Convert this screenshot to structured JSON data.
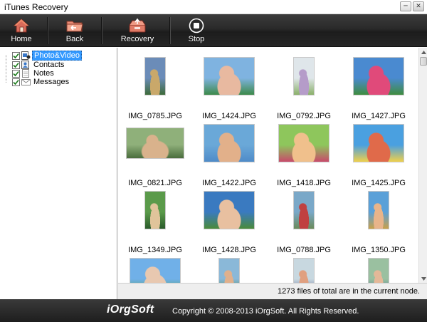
{
  "window": {
    "title": "iTunes Recovery",
    "minimize": "─",
    "close": "✕"
  },
  "toolbar": {
    "home": "Home",
    "back": "Back",
    "recovery": "Recovery",
    "stop": "Stop"
  },
  "tree": {
    "items": [
      {
        "label": "Photo&Video",
        "checked": true,
        "selected": true,
        "icon": "photo-video-icon"
      },
      {
        "label": "Contacts",
        "checked": true,
        "selected": false,
        "icon": "contacts-icon"
      },
      {
        "label": "Notes",
        "checked": true,
        "selected": false,
        "icon": "notes-icon"
      },
      {
        "label": "Messages",
        "checked": true,
        "selected": false,
        "icon": "messages-icon"
      }
    ]
  },
  "files": [
    {
      "name": "IMG_0785.JPG",
      "orient": "portrait",
      "colors": [
        "#6b8cb8",
        "#c9a86a",
        "#3d6b3a"
      ]
    },
    {
      "name": "IMG_1424.JPG",
      "orient": "landscape",
      "colors": [
        "#7fb3e0",
        "#e8b9a0",
        "#3c8a4a"
      ]
    },
    {
      "name": "IMG_0792.JPG",
      "orient": "portrait",
      "colors": [
        "#dfe6ea",
        "#b59cc9",
        "#8ab06a"
      ]
    },
    {
      "name": "IMG_1427.JPG",
      "orient": "landscape",
      "colors": [
        "#4a8ad0",
        "#e04a7a",
        "#3f8c3f"
      ]
    },
    {
      "name": "IMG_0821.JPG",
      "orient": "landscape",
      "colors": [
        "#8fb07a",
        "#d9b28c",
        "#4a6d3d"
      ]
    },
    {
      "name": "IMG_1422.JPG",
      "orient": "landscape",
      "colors": [
        "#6aa8d8",
        "#e2b08a",
        "#4f8bc8"
      ]
    },
    {
      "name": "IMG_1418.JPG",
      "orient": "landscape",
      "colors": [
        "#8ec65c",
        "#f0c08c",
        "#c84a6a"
      ]
    },
    {
      "name": "IMG_1425.JPG",
      "orient": "landscape",
      "colors": [
        "#4aa0e0",
        "#e06a4a",
        "#f0d04a"
      ]
    },
    {
      "name": "IMG_1349.JPG",
      "orient": "portrait",
      "colors": [
        "#5a9a4a",
        "#e0c49a",
        "#2a5a2a"
      ]
    },
    {
      "name": "IMG_1428.JPG",
      "orient": "landscape",
      "colors": [
        "#3a7ac0",
        "#e8c0a0",
        "#4a8a3a"
      ]
    },
    {
      "name": "IMG_0788.JPG",
      "orient": "portrait",
      "colors": [
        "#7aa8c8",
        "#c04040",
        "#6a8a5a"
      ]
    },
    {
      "name": "IMG_1350.JPG",
      "orient": "portrait",
      "colors": [
        "#5aa0d8",
        "#e8b48a",
        "#c8a04a"
      ]
    },
    {
      "name": "",
      "orient": "landscape",
      "colors": [
        "#70b0e8",
        "#e8c8b0",
        "#50a050"
      ]
    },
    {
      "name": "",
      "orient": "portrait",
      "colors": [
        "#8ab8d8",
        "#e0b08c",
        "#3a7a3a"
      ]
    },
    {
      "name": "",
      "orient": "portrait",
      "colors": [
        "#c8d8e0",
        "#e0a080",
        "#5a5a8a"
      ]
    },
    {
      "name": "",
      "orient": "portrait",
      "colors": [
        "#9ac0a0",
        "#e4b898",
        "#3a6a8a"
      ]
    }
  ],
  "status": "1273 files of total are in the current node.",
  "footer": {
    "brand": "iOrgSoft",
    "copyright": "Copyright © 2008-2013 iOrgSoft. All Rights Reserved."
  }
}
